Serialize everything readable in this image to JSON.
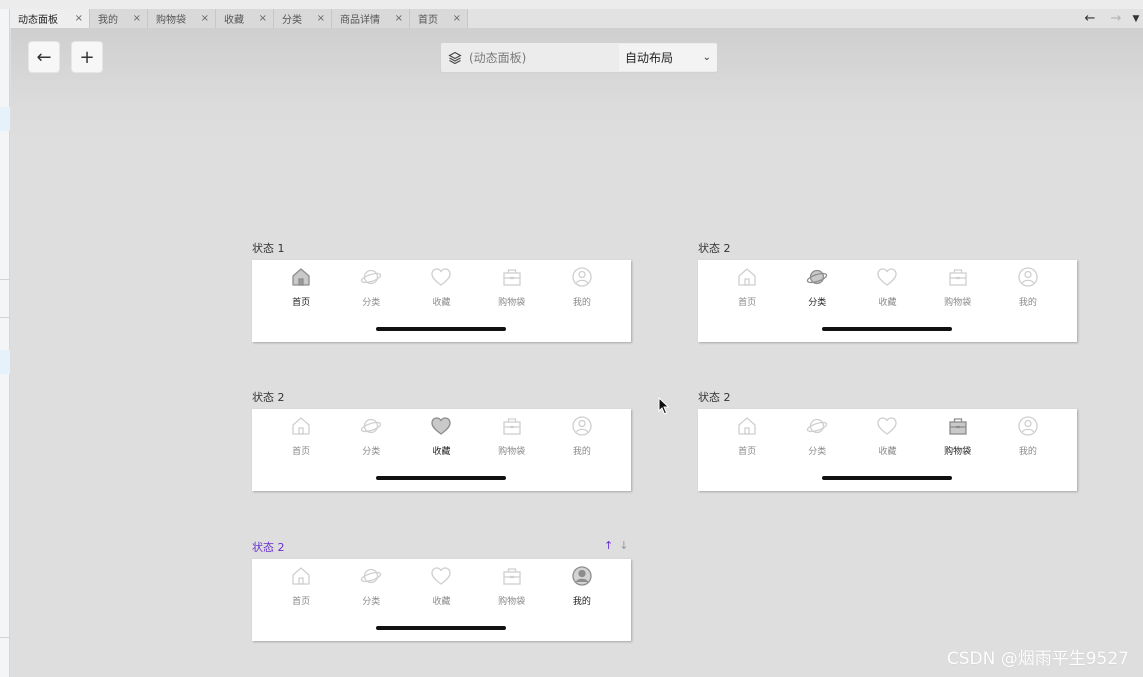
{
  "tabs": [
    {
      "label": "动态面板",
      "active": true
    },
    {
      "label": "我的"
    },
    {
      "label": "购物袋"
    },
    {
      "label": "收藏"
    },
    {
      "label": "分类"
    },
    {
      "label": "商品详情"
    },
    {
      "label": "首页"
    }
  ],
  "tab_close": "×",
  "tab_nav": {
    "back": "←",
    "forward": "→",
    "menu": "▼"
  },
  "toolbar": {
    "back": "←",
    "add": "+"
  },
  "panel_picker": {
    "name": "(动态面板)",
    "mode": "自动布局",
    "chevron": "⌄"
  },
  "nav_labels": [
    "首页",
    "分类",
    "收藏",
    "购物袋",
    "我的"
  ],
  "nav_icons": [
    "home-icon",
    "planet-icon",
    "heart-icon",
    "shopping-bag-icon",
    "user-icon"
  ],
  "states": [
    {
      "label": "状态 1",
      "active_index": 0
    },
    {
      "label": "状态 2",
      "active_index": 1
    },
    {
      "label": "状态 2",
      "active_index": 2
    },
    {
      "label": "状态 2",
      "active_index": 3
    },
    {
      "label": "状态 2",
      "active_index": 4,
      "selected": true
    }
  ],
  "reorder": {
    "up": "↑",
    "down": "↓"
  },
  "colors": {
    "selected_state": "#6a2fd1",
    "inactive_icon": "#cfcfcf",
    "active_icon": "#8d8d8d"
  },
  "watermark": "CSDN @烟雨平生9527"
}
